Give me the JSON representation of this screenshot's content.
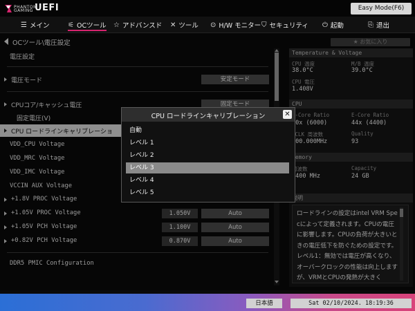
{
  "header": {
    "brand_small": "PHANTOM GAMING",
    "brand_large": "UEFI",
    "easy_mode_label": "Easy Mode(F6)"
  },
  "nav": {
    "items": [
      {
        "icon": "menu-icon",
        "label": "メイン"
      },
      {
        "icon": "oc-tweaker-icon",
        "label": "OCツール"
      },
      {
        "icon": "star-icon",
        "label": "アドバンスド"
      },
      {
        "icon": "wrench-icon",
        "label": "ツール"
      },
      {
        "icon": "monitor-icon",
        "label": "H/W モニター"
      },
      {
        "icon": "shield-icon",
        "label": "セキュリティ"
      },
      {
        "icon": "power-icon",
        "label": "起動"
      },
      {
        "icon": "exit-icon",
        "label": "退出"
      }
    ],
    "active_index": 1,
    "accent": "#d6246e"
  },
  "breadcrumb": "OCツール\\電圧設定",
  "favorite_label": "★ お気に入り",
  "settings": {
    "section_title": "電圧設定",
    "voltage_mode_label": "電圧モード",
    "voltage_mode_value": "安定モード",
    "cpu_core_label": "CPUコア/キャッシュ電圧",
    "cpu_core_value": "固定モード",
    "fixed_voltage_label": "固定電圧(V)",
    "loadline_label": "CPU ロードラインキャリブレーショ",
    "vdd_cpu": "VDD_CPU Voltage",
    "vdd_mrc": "VDD_MRC Voltage",
    "vdd_imc": "VDD_IMC Voltage",
    "vccin_aux": "VCCIN AUX Voltage",
    "v18_proc": "+1.8V PROC Voltage",
    "v105_proc": "+1.05V PROC Voltage",
    "v105_proc_value": "1.050V",
    "v105_proc_option": "Auto",
    "v105_pch": "+1.05V PCH Voltage",
    "v105_pch_value": "1.100V",
    "v105_pch_option": "Auto",
    "v082_pch": "+0.82V PCH Voltage",
    "v082_pch_value": "0.870V",
    "v082_pch_option": "Auto",
    "ddr5_pmic": "DDR5 PMIC Configuration"
  },
  "right_panel": {
    "temp_header": "Temperature & Voltage",
    "cpu_temp_label": "CPU 温度",
    "cpu_temp_value": "38.0°C",
    "mb_temp_label": "M/B 温度",
    "mb_temp_value": "39.0°C",
    "cpu_volt_label": "CPU 電圧",
    "cpu_volt_value": "1.408V",
    "cpu_header": "CPU",
    "pcore_label": "P-Core Ratio",
    "pcore_value": "60x (6000)",
    "ecore_label": "E-Core Ratio",
    "ecore_value": "44x (4400)",
    "bclk_label": "BCLK 周波数",
    "bclk_value": "100.000MHz",
    "quality_label": "Quality",
    "quality_value": "93",
    "memory_header": "Memory",
    "freq_label": "周波数",
    "freq_value": "6400 MHz",
    "capacity_label": "Capacity",
    "capacity_value": "24 GB",
    "desc_header": "説明",
    "description": "ロードラインの設定はintel VRM Specによって定義されます。CPUの電圧に影響します。CPUの負荷が大きいときの電圧低下を防ぐための設定です。レベル1：無効では電圧が高くなり、オーバークロックの性能は向上しますが、VRMとCPUの発熱が大きく"
  },
  "modal": {
    "title": "CPU ロードラインキャリブレーション",
    "options": [
      "自動",
      "レベル 1",
      "レベル 2",
      "レベル 3",
      "レベル 4",
      "レベル 5"
    ],
    "selected_index": 3
  },
  "footer": {
    "language": "日本語",
    "datetime": "Sat 02/10/2024. 18:19:36"
  }
}
